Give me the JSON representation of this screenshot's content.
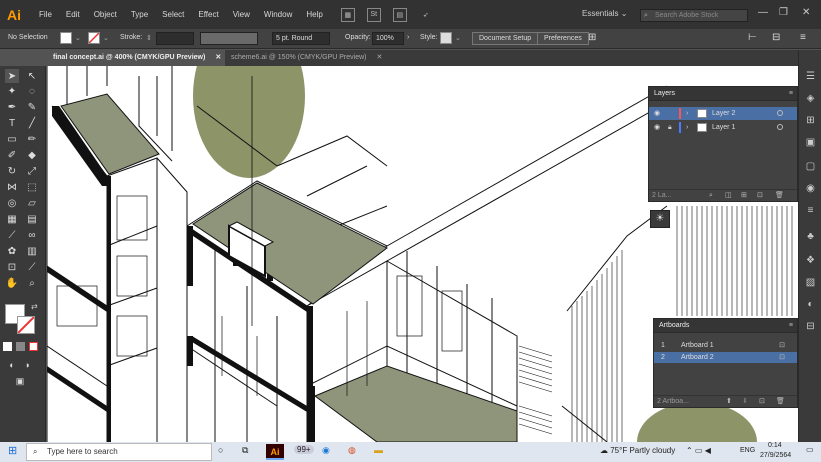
{
  "app": {
    "logo": "Ai"
  },
  "menu": [
    "File",
    "Edit",
    "Object",
    "Type",
    "Select",
    "Effect",
    "View",
    "Window",
    "Help"
  ],
  "menubar_icons": {
    "stock": "St"
  },
  "workspace": "Essentials",
  "search": {
    "placeholder": "Search Adobe Stock"
  },
  "window_controls": {
    "minimize": "—",
    "restore": "❐",
    "close": "✕"
  },
  "control_bar": {
    "selection_label": "No Selection",
    "stroke_label": "Stroke:",
    "brush": "5 pt. Round",
    "opacity_label": "Opacity:",
    "opacity_value": "100%",
    "style_label": "Style:",
    "document_setup": "Document Setup",
    "preferences": "Preferences"
  },
  "tabs": [
    {
      "label": "final concept.ai @ 400% (CMYK/GPU Preview)",
      "close": "✕",
      "active": true
    },
    {
      "label": "scheme6.ai @ 150% (CMYK/GPU Preview)",
      "close": "✕",
      "active": false
    }
  ],
  "layers_panel": {
    "title": "Layers",
    "layers": [
      {
        "name": "Layer 2",
        "color": "#ff5252",
        "selected": true
      },
      {
        "name": "Layer 1",
        "color": "#4a7bff",
        "selected": false
      }
    ],
    "footer": "2 La..."
  },
  "artboards_panel": {
    "title": "Artboards",
    "items": [
      {
        "num": "1",
        "name": "Artboard 1",
        "selected": false
      },
      {
        "num": "2",
        "name": "Artboard 2",
        "selected": true
      }
    ],
    "footer": "2 Artboa..."
  },
  "taskbar": {
    "search_placeholder": "Type here to search",
    "badge": "99+",
    "weather": "75°F  Partly cloudy",
    "lang": "ENG",
    "time": "0:14",
    "date": "27/9/2564"
  },
  "colors": {
    "accent_selected": "#4a6fa5",
    "drawing_fill": "#8f957a",
    "circle_fill": "#8c9468"
  }
}
